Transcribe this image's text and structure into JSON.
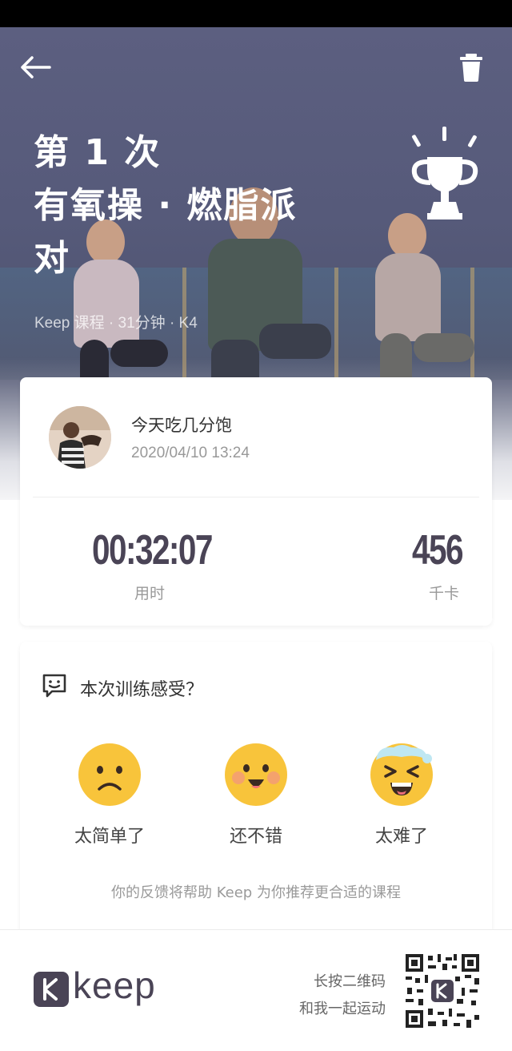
{
  "header": {
    "title_lines": [
      "第 1 次",
      "有氧操 · 燃脂派",
      "对"
    ],
    "meta": "Keep 课程 · 31分钟 · K4"
  },
  "user": {
    "name": "今天吃几分饱",
    "datetime": "2020/04/10 13:24"
  },
  "stats": {
    "duration_value": "00:32:07",
    "duration_label": "用时",
    "kcal_value": "456",
    "kcal_label": "千卡"
  },
  "feedback": {
    "title": "本次训练感受？",
    "options": [
      {
        "label": "太简单了",
        "icon": "sad-face-icon"
      },
      {
        "label": "还不错",
        "icon": "happy-face-icon"
      },
      {
        "label": "太难了",
        "icon": "exhausted-face-icon"
      }
    ],
    "hint": "你的反馈将帮助 Keep 为你推荐更合适的课程"
  },
  "footer": {
    "brand": "keep",
    "qr_hint_line1": "长按二维码",
    "qr_hint_line2": "和我一起运动"
  },
  "colors": {
    "accent": "#4a4456",
    "emoji_yellow": "#f8c43b"
  }
}
